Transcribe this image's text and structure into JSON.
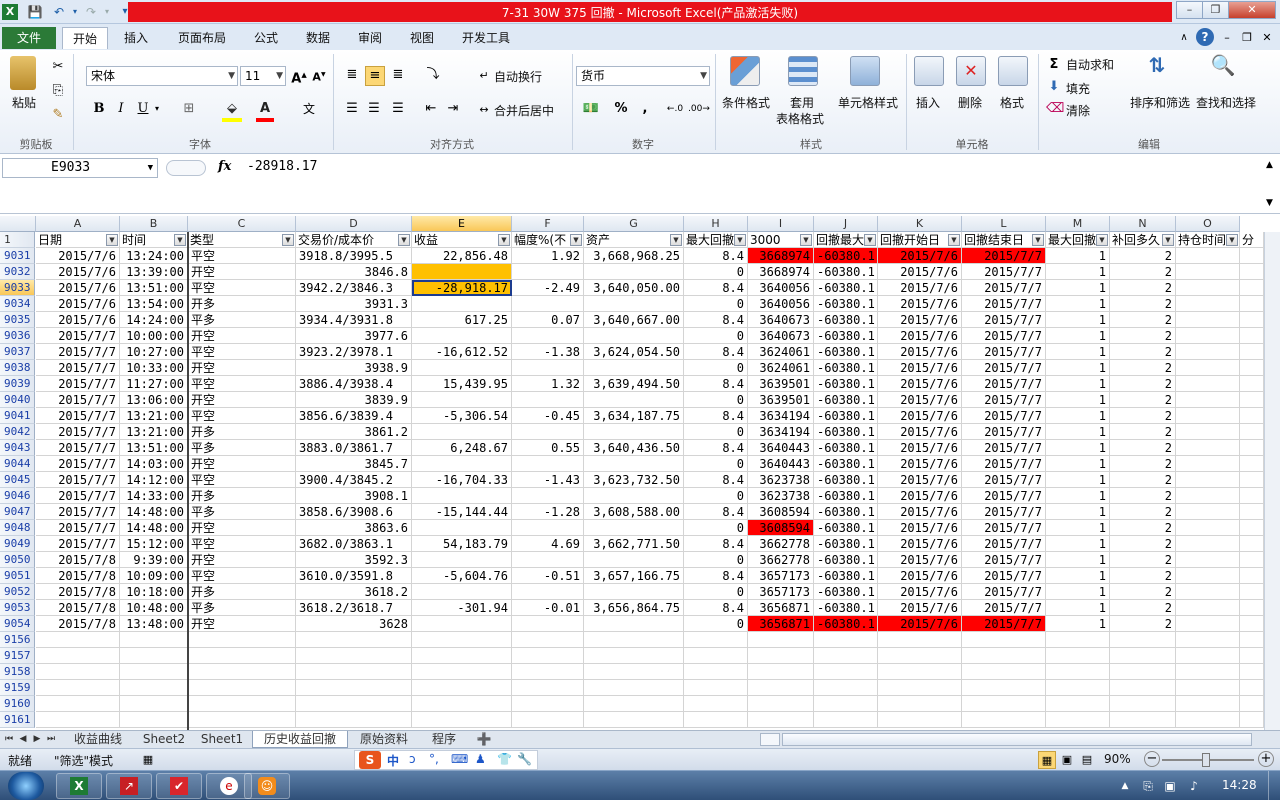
{
  "window": {
    "title": "7-31 30W 375  回撤 - Microsoft Excel(产品激活失败)",
    "accent": "#e8121a"
  },
  "quick_access": [
    "excel-icon",
    "save-icon",
    "undo-icon",
    "redo-icon",
    "customize-icon"
  ],
  "ribbon_tabs": [
    "文件",
    "开始",
    "插入",
    "页面布局",
    "公式",
    "数据",
    "审阅",
    "视图",
    "开发工具"
  ],
  "ribbon": {
    "clipboard": {
      "paste": "粘贴",
      "label": "剪贴板"
    },
    "font": {
      "name": "宋体",
      "size": "11",
      "label": "字体",
      "bold": "B",
      "italic": "I",
      "underline": "U"
    },
    "alignment": {
      "wrap": "自动换行",
      "merge": "合并后居中",
      "label": "对齐方式"
    },
    "number": {
      "format": "货币",
      "percent": "%",
      "comma": ",",
      "label": "数字"
    },
    "styles": {
      "conditional": "条件格式",
      "table1": "套用",
      "table2": "表格格式",
      "cell_style": "单元格样式",
      "label": "样式"
    },
    "cells": {
      "insert": "插入",
      "delete": "删除",
      "format": "格式",
      "label": "单元格"
    },
    "editing": {
      "autosum": "自动求和",
      "fill": "填充",
      "clear": "清除",
      "sort": "排序和筛选",
      "find": "查找和选择",
      "label": "编辑"
    }
  },
  "formula_bar": {
    "name_box": "E9033",
    "fx": "fx",
    "value": "-28918.17"
  },
  "columns": [
    "A",
    "B",
    "C",
    "D",
    "E",
    "F",
    "G",
    "H",
    "I",
    "J",
    "K",
    "L",
    "M",
    "N",
    "O"
  ],
  "header_row": {
    "row_num": "1",
    "cells": [
      "日期",
      "时间",
      "类型",
      "交易价/成本价",
      "收益",
      "幅度%(不",
      "资产",
      "最大回撤",
      "3000",
      "回撤最大",
      "回撤开始日",
      "回撤结束日",
      "最大回撤",
      "补回多久",
      "持仓时间",
      "分"
    ]
  },
  "rows": [
    {
      "n": "9031",
      "a": "2015/7/6",
      "b": "13:24:00",
      "c": "平空",
      "d": "3918.8/3995.5",
      "e": "22,856.48",
      "f": "1.92",
      "g": "3,668,968.25",
      "h": "8.4",
      "i": "3668974",
      "j": "-60380.1",
      "k": "2015/7/6",
      "l": "2015/7/7",
      "m": "1",
      "n2": "2",
      "red": true
    },
    {
      "n": "9032",
      "a": "2015/7/6",
      "b": "13:39:00",
      "c": "开空",
      "d": "3846.8",
      "e": "",
      "f": "",
      "g": "",
      "h": "0",
      "i": "3668974",
      "j": "-60380.1",
      "k": "2015/7/6",
      "l": "2015/7/7",
      "m": "1",
      "n2": "2",
      "orangeE": true
    },
    {
      "n": "9033",
      "a": "2015/7/6",
      "b": "13:51:00",
      "c": "平空",
      "d": "3942.2/3846.3",
      "e": "-28,918.17",
      "f": "-2.49",
      "g": "3,640,050.00",
      "h": "8.4",
      "i": "3640056",
      "j": "-60380.1",
      "k": "2015/7/6",
      "l": "2015/7/7",
      "m": "1",
      "n2": "2",
      "sel": true
    },
    {
      "n": "9034",
      "a": "2015/7/6",
      "b": "13:54:00",
      "c": "开多",
      "d": "3931.3",
      "e": "",
      "f": "",
      "g": "",
      "h": "0",
      "i": "3640056",
      "j": "-60380.1",
      "k": "2015/7/6",
      "l": "2015/7/7",
      "m": "1",
      "n2": "2"
    },
    {
      "n": "9035",
      "a": "2015/7/6",
      "b": "14:24:00",
      "c": "平多",
      "d": "3934.4/3931.8",
      "e": "617.25",
      "f": "0.07",
      "g": "3,640,667.00",
      "h": "8.4",
      "i": "3640673",
      "j": "-60380.1",
      "k": "2015/7/6",
      "l": "2015/7/7",
      "m": "1",
      "n2": "2"
    },
    {
      "n": "9036",
      "a": "2015/7/7",
      "b": "10:00:00",
      "c": "开空",
      "d": "3977.6",
      "e": "",
      "f": "",
      "g": "",
      "h": "0",
      "i": "3640673",
      "j": "-60380.1",
      "k": "2015/7/6",
      "l": "2015/7/7",
      "m": "1",
      "n2": "2"
    },
    {
      "n": "9037",
      "a": "2015/7/7",
      "b": "10:27:00",
      "c": "平空",
      "d": "3923.2/3978.1",
      "e": "-16,612.52",
      "f": "-1.38",
      "g": "3,624,054.50",
      "h": "8.4",
      "i": "3624061",
      "j": "-60380.1",
      "k": "2015/7/6",
      "l": "2015/7/7",
      "m": "1",
      "n2": "2"
    },
    {
      "n": "9038",
      "a": "2015/7/7",
      "b": "10:33:00",
      "c": "开空",
      "d": "3938.9",
      "e": "",
      "f": "",
      "g": "",
      "h": "0",
      "i": "3624061",
      "j": "-60380.1",
      "k": "2015/7/6",
      "l": "2015/7/7",
      "m": "1",
      "n2": "2"
    },
    {
      "n": "9039",
      "a": "2015/7/7",
      "b": "11:27:00",
      "c": "平空",
      "d": "3886.4/3938.4",
      "e": "15,439.95",
      "f": "1.32",
      "g": "3,639,494.50",
      "h": "8.4",
      "i": "3639501",
      "j": "-60380.1",
      "k": "2015/7/6",
      "l": "2015/7/7",
      "m": "1",
      "n2": "2"
    },
    {
      "n": "9040",
      "a": "2015/7/7",
      "b": "13:06:00",
      "c": "开空",
      "d": "3839.9",
      "e": "",
      "f": "",
      "g": "",
      "h": "0",
      "i": "3639501",
      "j": "-60380.1",
      "k": "2015/7/6",
      "l": "2015/7/7",
      "m": "1",
      "n2": "2"
    },
    {
      "n": "9041",
      "a": "2015/7/7",
      "b": "13:21:00",
      "c": "平空",
      "d": "3856.6/3839.4",
      "e": "-5,306.54",
      "f": "-0.45",
      "g": "3,634,187.75",
      "h": "8.4",
      "i": "3634194",
      "j": "-60380.1",
      "k": "2015/7/6",
      "l": "2015/7/7",
      "m": "1",
      "n2": "2"
    },
    {
      "n": "9042",
      "a": "2015/7/7",
      "b": "13:21:00",
      "c": "开多",
      "d": "3861.2",
      "e": "",
      "f": "",
      "g": "",
      "h": "0",
      "i": "3634194",
      "j": "-60380.1",
      "k": "2015/7/6",
      "l": "2015/7/7",
      "m": "1",
      "n2": "2"
    },
    {
      "n": "9043",
      "a": "2015/7/7",
      "b": "13:51:00",
      "c": "平多",
      "d": "3883.0/3861.7",
      "e": "6,248.67",
      "f": "0.55",
      "g": "3,640,436.50",
      "h": "8.4",
      "i": "3640443",
      "j": "-60380.1",
      "k": "2015/7/6",
      "l": "2015/7/7",
      "m": "1",
      "n2": "2"
    },
    {
      "n": "9044",
      "a": "2015/7/7",
      "b": "14:03:00",
      "c": "开空",
      "d": "3845.7",
      "e": "",
      "f": "",
      "g": "",
      "h": "0",
      "i": "3640443",
      "j": "-60380.1",
      "k": "2015/7/6",
      "l": "2015/7/7",
      "m": "1",
      "n2": "2"
    },
    {
      "n": "9045",
      "a": "2015/7/7",
      "b": "14:12:00",
      "c": "平空",
      "d": "3900.4/3845.2",
      "e": "-16,704.33",
      "f": "-1.43",
      "g": "3,623,732.50",
      "h": "8.4",
      "i": "3623738",
      "j": "-60380.1",
      "k": "2015/7/6",
      "l": "2015/7/7",
      "m": "1",
      "n2": "2"
    },
    {
      "n": "9046",
      "a": "2015/7/7",
      "b": "14:33:00",
      "c": "开多",
      "d": "3908.1",
      "e": "",
      "f": "",
      "g": "",
      "h": "0",
      "i": "3623738",
      "j": "-60380.1",
      "k": "2015/7/6",
      "l": "2015/7/7",
      "m": "1",
      "n2": "2"
    },
    {
      "n": "9047",
      "a": "2015/7/7",
      "b": "14:48:00",
      "c": "平多",
      "d": "3858.6/3908.6",
      "e": "-15,144.44",
      "f": "-1.28",
      "g": "3,608,588.00",
      "h": "8.4",
      "i": "3608594",
      "j": "-60380.1",
      "k": "2015/7/6",
      "l": "2015/7/7",
      "m": "1",
      "n2": "2"
    },
    {
      "n": "9048",
      "a": "2015/7/7",
      "b": "14:48:00",
      "c": "开空",
      "d": "3863.6",
      "e": "",
      "f": "",
      "g": "",
      "h": "0",
      "i": "3608594",
      "j": "-60380.1",
      "k": "2015/7/6",
      "l": "2015/7/7",
      "m": "1",
      "n2": "2",
      "redI": true
    },
    {
      "n": "9049",
      "a": "2015/7/7",
      "b": "15:12:00",
      "c": "平空",
      "d": "3682.0/3863.1",
      "e": "54,183.79",
      "f": "4.69",
      "g": "3,662,771.50",
      "h": "8.4",
      "i": "3662778",
      "j": "-60380.1",
      "k": "2015/7/6",
      "l": "2015/7/7",
      "m": "1",
      "n2": "2"
    },
    {
      "n": "9050",
      "a": "2015/7/8",
      "b": "9:39:00",
      "c": "开空",
      "d": "3592.3",
      "e": "",
      "f": "",
      "g": "",
      "h": "0",
      "i": "3662778",
      "j": "-60380.1",
      "k": "2015/7/6",
      "l": "2015/7/7",
      "m": "1",
      "n2": "2"
    },
    {
      "n": "9051",
      "a": "2015/7/8",
      "b": "10:09:00",
      "c": "平空",
      "d": "3610.0/3591.8",
      "e": "-5,604.76",
      "f": "-0.51",
      "g": "3,657,166.75",
      "h": "8.4",
      "i": "3657173",
      "j": "-60380.1",
      "k": "2015/7/6",
      "l": "2015/7/7",
      "m": "1",
      "n2": "2"
    },
    {
      "n": "9052",
      "a": "2015/7/8",
      "b": "10:18:00",
      "c": "开多",
      "d": "3618.2",
      "e": "",
      "f": "",
      "g": "",
      "h": "0",
      "i": "3657173",
      "j": "-60380.1",
      "k": "2015/7/6",
      "l": "2015/7/7",
      "m": "1",
      "n2": "2"
    },
    {
      "n": "9053",
      "a": "2015/7/8",
      "b": "10:48:00",
      "c": "平多",
      "d": "3618.2/3618.7",
      "e": "-301.94",
      "f": "-0.01",
      "g": "3,656,864.75",
      "h": "8.4",
      "i": "3656871",
      "j": "-60380.1",
      "k": "2015/7/6",
      "l": "2015/7/7",
      "m": "1",
      "n2": "2"
    },
    {
      "n": "9054",
      "a": "2015/7/8",
      "b": "13:48:00",
      "c": "开空",
      "d": "3628",
      "e": "",
      "f": "",
      "g": "",
      "h": "0",
      "i": "3656871",
      "j": "-60380.1",
      "k": "2015/7/6",
      "l": "2015/7/7",
      "m": "1",
      "n2": "2",
      "red": true
    }
  ],
  "empty_rows": [
    "9156",
    "9157",
    "9158",
    "9159",
    "9160",
    "9161"
  ],
  "sheet_tabs": [
    "收益曲线",
    "Sheet2",
    "Sheet1",
    "历史收益回撤",
    "原始资料",
    "程序"
  ],
  "active_sheet": "历史收益回撤",
  "status": {
    "ready": "就绪",
    "mode": "\"筛选\"模式",
    "zoom": "90%"
  },
  "ime_bar": [
    "S",
    "中",
    "ɔ",
    "°,",
    "⌨",
    "♟",
    "👕",
    "🔧"
  ],
  "taskbar": {
    "clock": "14:28"
  },
  "colors": {
    "red_highlight": "#ff0000",
    "orange_highlight": "#ffc000",
    "selection": "#1d3c8f",
    "file_tab": "#2b7a37"
  }
}
